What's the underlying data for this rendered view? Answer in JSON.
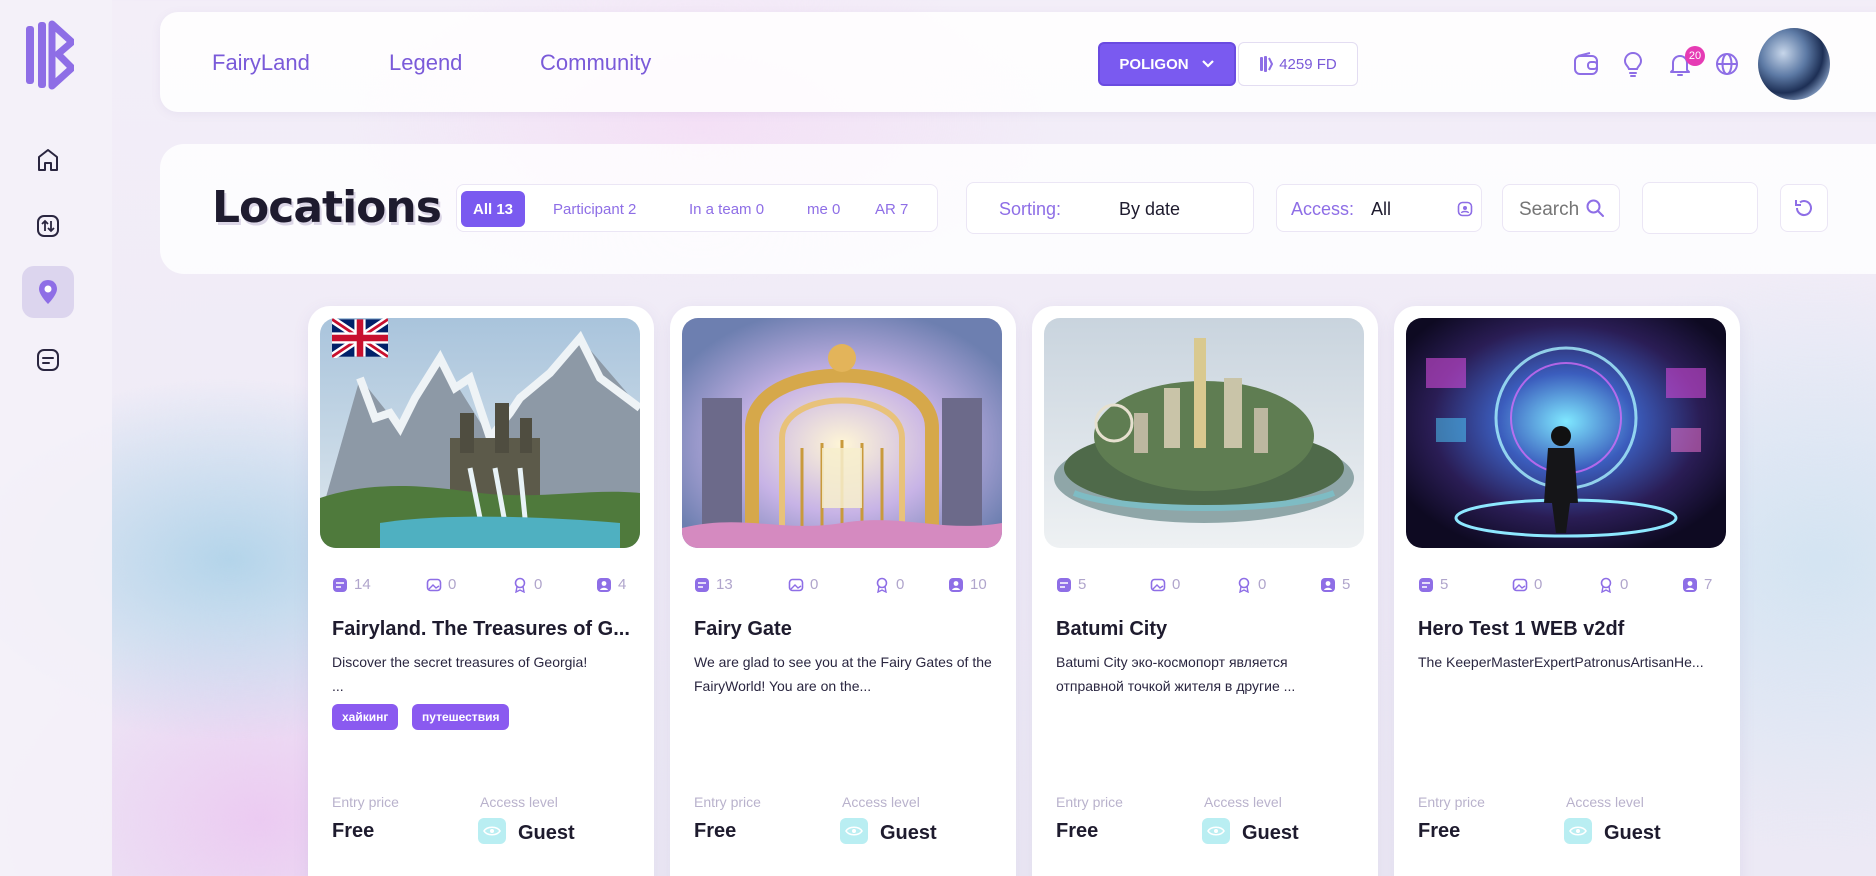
{
  "nav": {
    "links": [
      "FairyLand",
      "Legend",
      "Community"
    ],
    "network": "POLIGON",
    "balance": "4259 FD",
    "notifications_count": "20"
  },
  "sidebar": {
    "items": [
      "home-icon",
      "exchange-icon",
      "location-pin-icon",
      "chat-icon"
    ],
    "active": "location-pin-icon"
  },
  "page": {
    "title": "Locations",
    "tabs": [
      "All 13",
      "Participant 2",
      "In a team 0",
      "me 0",
      "AR 7"
    ],
    "sorting_label": "Sorting:",
    "sorting_value": "By date",
    "access_label": "Access:",
    "access_value": "All",
    "search_placeholder": "Search"
  },
  "labels": {
    "entry_price": "Entry price",
    "access_level": "Access level"
  },
  "cards": [
    {
      "title": "Fairyland. The Treasures of G...",
      "desc": "Discover the secret treasures of Georgia!\n...",
      "stats": [
        "14",
        "0",
        "0",
        "4"
      ],
      "tags": [
        "хайкинг",
        "путешествия"
      ],
      "price": "Free",
      "access": "Guest"
    },
    {
      "title": "Fairy Gate",
      "desc": "We are glad to see you at the Fairy Gates of the FairyWorld! You are on the...",
      "stats": [
        "13",
        "0",
        "0",
        "10"
      ],
      "tags": [],
      "price": "Free",
      "access": "Guest"
    },
    {
      "title": "Batumi City",
      "desc": "Batumi City эко-космопорт является отправной точкой жителя в другие ...",
      "stats": [
        "5",
        "0",
        "0",
        "5"
      ],
      "tags": [],
      "price": "Free",
      "access": "Guest"
    },
    {
      "title": "Hero Test 1 WEB v2df",
      "desc": "The KeeperMasterExpertPatronusArtisanHe...",
      "stats": [
        "5",
        "0",
        "0",
        "7"
      ],
      "tags": [],
      "price": "Free",
      "access": "Guest"
    }
  ],
  "colors": {
    "accent": "#7a5af0",
    "text": "#1e1b2e"
  }
}
